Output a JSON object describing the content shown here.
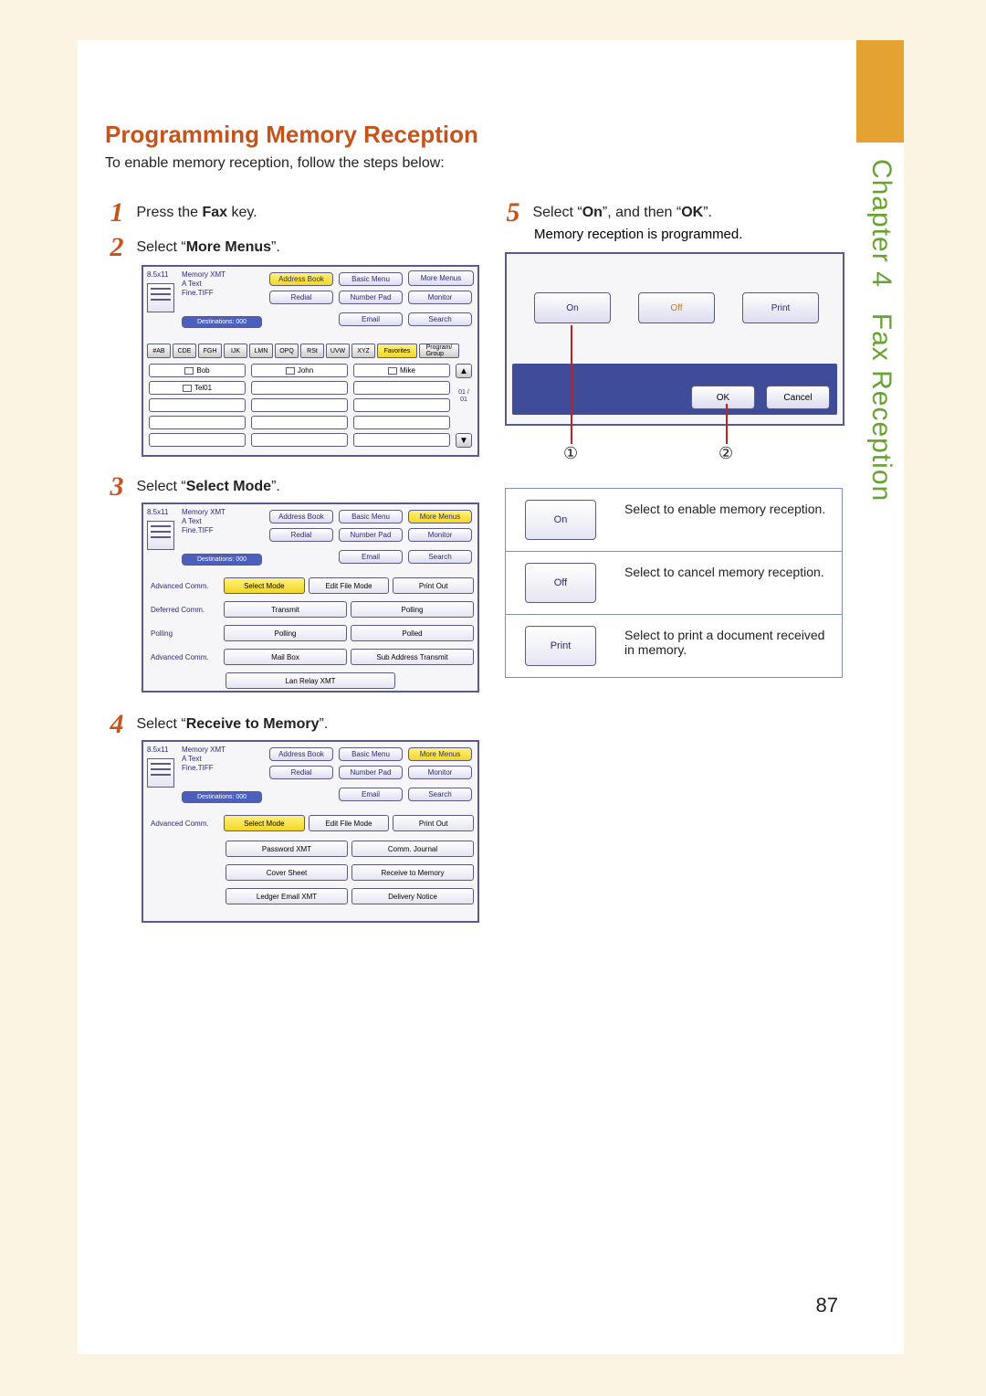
{
  "sidebar": {
    "chapter": "Chapter 4",
    "section": "Fax Reception"
  },
  "title": "Programming Memory Reception",
  "intro": "To enable memory reception, follow the steps below:",
  "steps": {
    "s1": {
      "num": "1",
      "pre": "Press the ",
      "bold": "Fax",
      "post": " key."
    },
    "s2": {
      "num": "2",
      "pre": "Select “",
      "bold": "More Menus",
      "post": "”."
    },
    "s3": {
      "num": "3",
      "pre": "Select “",
      "bold": "Select Mode",
      "post": "”."
    },
    "s4": {
      "num": "4",
      "pre": "Select “",
      "bold": "Receive to Memory",
      "post": "”."
    },
    "s5": {
      "num": "5",
      "pre": "Select “",
      "bold": "On",
      "mid": "”, and then “",
      "bold2": "OK",
      "post": "”."
    },
    "s5_sub": "Memory reception is programmed."
  },
  "panel_top": {
    "size": "8.5x11",
    "header": "Memory XMT",
    "a_text": "A   Text",
    "fine": "Fine.TIFF",
    "dest": "Destinations: 000",
    "btns": {
      "address": "Address Book",
      "basic": "Basic Menu",
      "more": "More Menus",
      "redial": "Redial",
      "number": "Number Pad",
      "monitor": "Monitor",
      "email": "Email",
      "search": "Search"
    }
  },
  "panel1": {
    "alpha": [
      "#AB",
      "CDE",
      "FGH",
      "IJK",
      "LMN",
      "OPQ",
      "RSt",
      "UVW",
      "XYZ"
    ],
    "fav": "Favorites",
    "prog": "Program/\nGroup",
    "names": [
      "Bob",
      "John",
      "Mike",
      "Tel01"
    ],
    "page": "01 / 01"
  },
  "panel2": {
    "rows": {
      "r1": {
        "label": "Advanced Comm.",
        "cells": [
          "Select Mode",
          "Edit File Mode",
          "Print Out"
        ]
      },
      "r2": {
        "label": "Deferred Comm.",
        "cells": [
          "Transmit",
          "Polling"
        ]
      },
      "r3": {
        "label": "Polling",
        "cells": [
          "Polling",
          "Polled"
        ]
      },
      "r4": {
        "label": "Advanced Comm.",
        "cells": [
          "Mail Box",
          "Sub Address Transmit"
        ]
      },
      "r5": {
        "cells": [
          "Lan Relay XMT"
        ]
      }
    }
  },
  "panel3": {
    "rows": {
      "r1": {
        "label": "Advanced Comm.",
        "cells": [
          "Select Mode",
          "Edit File Mode",
          "Print Out"
        ]
      },
      "r2": {
        "cells": [
          "Password XMT",
          "Comm. Journal"
        ]
      },
      "r3": {
        "cells": [
          "Cover Sheet",
          "Receive to Memory"
        ]
      },
      "r4": {
        "cells": [
          "Ledger Email XMT",
          "Delivery Notice"
        ]
      }
    }
  },
  "panel5": {
    "on": "On",
    "off": "Off",
    "print": "Print",
    "ok": "OK",
    "cancel": "Cancel"
  },
  "callouts": {
    "c1": "①",
    "c2": "②"
  },
  "explain": {
    "on": {
      "btn": "On",
      "text": "Select to enable memory reception."
    },
    "off": {
      "btn": "Off",
      "text": "Select to cancel memory reception."
    },
    "print": {
      "btn": "Print",
      "text": "Select to print a document received in memory."
    }
  },
  "page_number": "87"
}
